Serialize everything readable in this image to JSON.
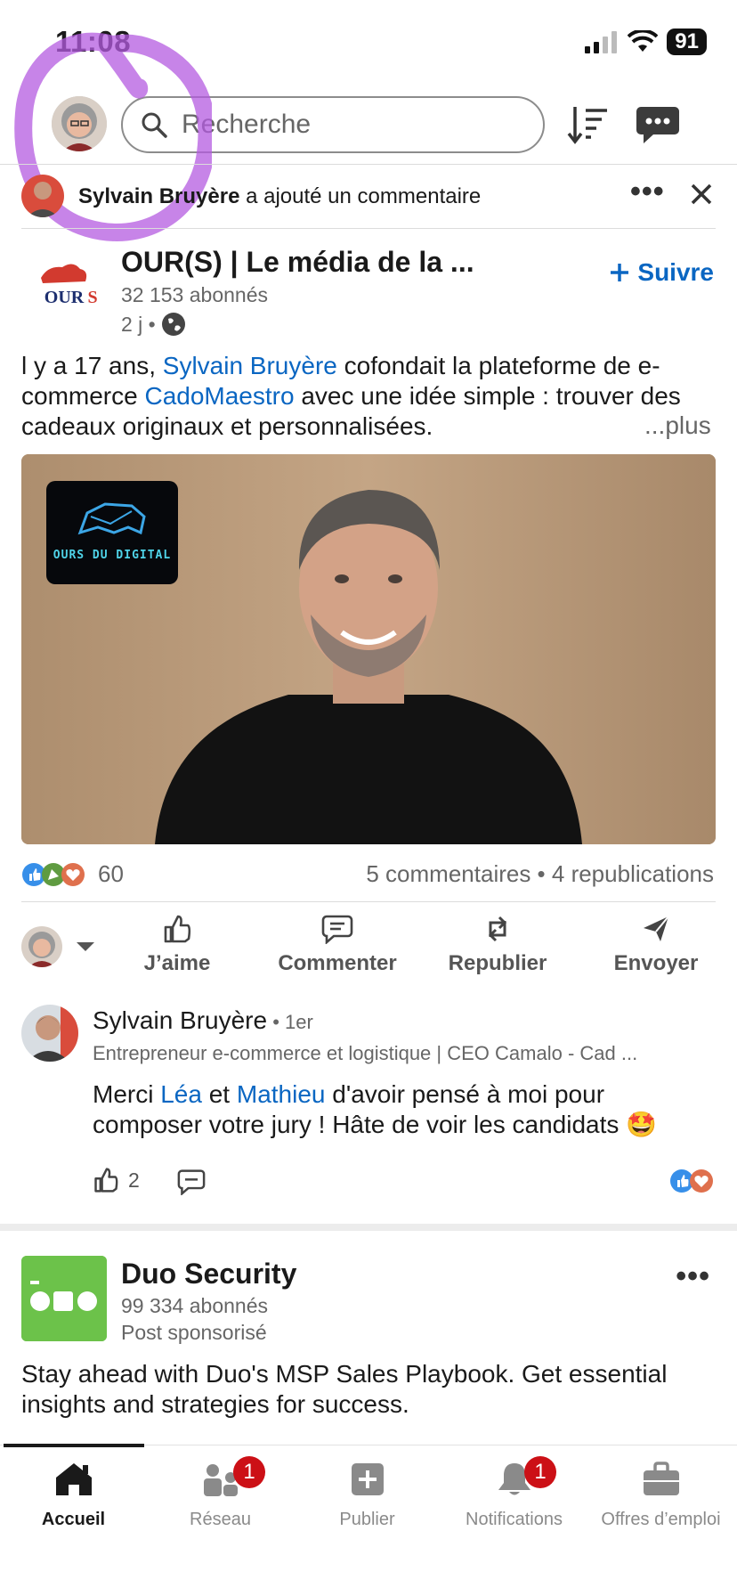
{
  "status_bar": {
    "time": "11:08",
    "battery": "91"
  },
  "header": {
    "search_placeholder": "Recherche"
  },
  "context": {
    "actor": "Sylvain Bruyère",
    "action": "a ajouté un commentaire"
  },
  "post": {
    "author": "OUR(S) | Le média de la ...",
    "followers": "32 153 abonnés",
    "age": "2 j •",
    "follow_label": "Suivre",
    "text_parts": {
      "p1": "l y a 17 ans, ",
      "link1": "Sylvain Bruyère",
      "p2": " cofondait la plateforme de e-commerce ",
      "link2": "CadoMaestro",
      "p3": " avec une idée simple : trouver des cadeaux originaux et personnalisées."
    },
    "more_label": "...plus",
    "image_badge_text": "OURS DU DIGITAL",
    "reaction_count": "60",
    "stats": "5 commentaires • 4 republications"
  },
  "actions": [
    {
      "label": "J’aime",
      "icon": "like-icon"
    },
    {
      "label": "Commenter",
      "icon": "comment-icon"
    },
    {
      "label": "Republier",
      "icon": "repost-icon"
    },
    {
      "label": "Envoyer",
      "icon": "send-icon"
    }
  ],
  "comment": {
    "author": "Sylvain Bruyère",
    "degree": " • 1er",
    "headline": "Entrepreneur e-commerce et logistique | CEO Camalo - Cad ...",
    "text_parts": {
      "p1": "Merci ",
      "link1": "Léa",
      "p2": " et ",
      "link2": "Mathieu",
      "p3": " d'avoir pensé à moi pour composer votre jury ! Hâte de voir les candidats 🤩"
    },
    "like_count": "2"
  },
  "sponsored": {
    "name": "Duo Security",
    "followers": "99 334 abonnés",
    "label": "Post sponsorisé",
    "text": "Stay ahead with Duo's MSP Sales Playbook. Get essential insights and strategies for success."
  },
  "nav": [
    {
      "label": "Accueil",
      "icon": "home-icon",
      "active": true
    },
    {
      "label": "Réseau",
      "icon": "network-icon",
      "badge": "1"
    },
    {
      "label": "Publier",
      "icon": "post-icon"
    },
    {
      "label": "Notifications",
      "icon": "bell-icon",
      "badge": "1"
    },
    {
      "label": "Offres d’emploi",
      "icon": "briefcase-icon"
    }
  ],
  "colors": {
    "link": "#0a66c2",
    "badge": "#cc1016",
    "annotation": "#b45be0",
    "duo_green": "#6cc24a"
  }
}
